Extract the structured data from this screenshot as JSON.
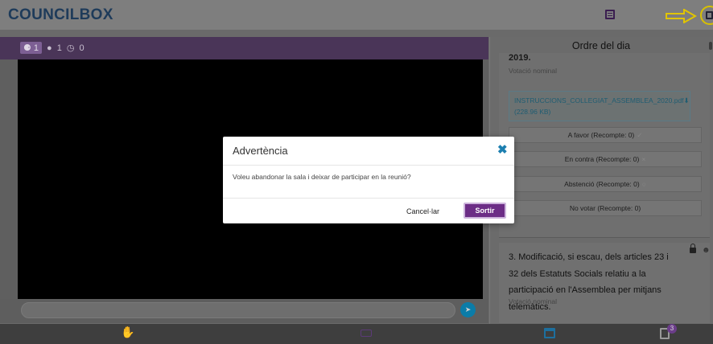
{
  "app": {
    "logo": "COUNCILBOX"
  },
  "video": {
    "participants_count": "1",
    "online_count": "1",
    "timer_count": "0"
  },
  "agenda": {
    "title": "Ordre del dia",
    "item1": {
      "title_tail": "2019.",
      "vote_type": "Votació nominal",
      "attachment_name": "INSTRUCCIONS_COLLEGIAT_ASSEMBLEA_2020.pdf",
      "attachment_size": "(228.96 KB)",
      "buttons": [
        "A favor (Recompte: 0)",
        "En contra (Recompte: 0)",
        "Abstenció (Recompte: 0)",
        "No votar (Recompte: 0)"
      ]
    },
    "item2": {
      "title": "3. Modificació, si escau, dels articles 23 i 32 dels Estatuts Socials relatiu a la participació en l'Assemblea per mitjans telemàtics.",
      "vote_type": "Votació nominal"
    }
  },
  "bottom": {
    "doc_badge": "3"
  },
  "modal": {
    "title": "Advertència",
    "message": "Voleu abandonar la sala i deixar de participar en la reunió?",
    "cancel_label": "Cancel·lar",
    "confirm_label": "Sortir"
  },
  "colors": {
    "brand_purple": "#6c2d86",
    "link_blue": "#1c7fb0",
    "highlight_yellow": "#d8c000"
  }
}
